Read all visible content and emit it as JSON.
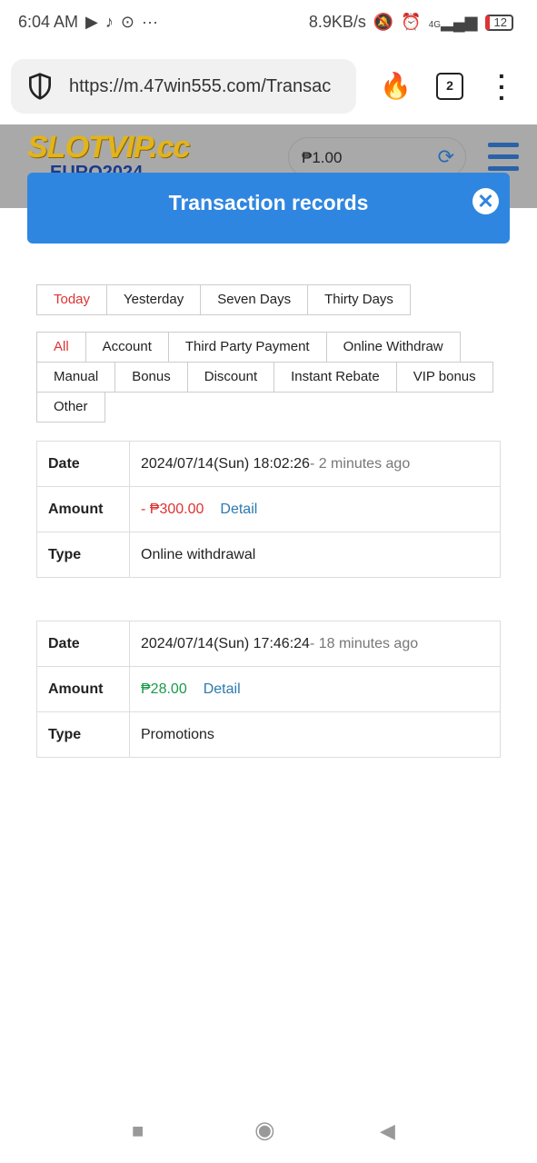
{
  "status": {
    "time": "6:04 AM",
    "speed": "8.9KB/s",
    "network": "4G",
    "battery": "12"
  },
  "browser": {
    "url": "https://m.47win555.com/Transac",
    "tab_count": "2"
  },
  "site": {
    "logo": "SLOTVIP.cc",
    "logo_sub": "EURO2024",
    "balance": "₱1.00"
  },
  "modal": {
    "title": "Transaction records"
  },
  "periods": [
    {
      "label": "Today",
      "active": true
    },
    {
      "label": "Yesterday"
    },
    {
      "label": "Seven Days"
    },
    {
      "label": "Thirty Days"
    }
  ],
  "categories": [
    {
      "label": "All",
      "active": true
    },
    {
      "label": "Account"
    },
    {
      "label": "Third Party Payment"
    },
    {
      "label": "Online Withdraw"
    },
    {
      "label": "Manual"
    },
    {
      "label": "Bonus"
    },
    {
      "label": "Discount"
    },
    {
      "label": "Instant Rebate"
    },
    {
      "label": "VIP bonus"
    },
    {
      "label": "Other"
    }
  ],
  "labels": {
    "date": "Date",
    "amount": "Amount",
    "type": "Type",
    "detail": "Detail"
  },
  "records": [
    {
      "date": "2024/07/14(Sun) 18:02:26",
      "ago": "- 2 minutes ago",
      "amount": "- ₱300.00",
      "amount_color": "#d33333",
      "type": "Online withdrawal"
    },
    {
      "date": "2024/07/14(Sun) 17:46:24",
      "ago": "- 18 minutes ago",
      "amount": "₱28.00",
      "amount_color": "#1a9a4a",
      "type": "Promotions"
    }
  ]
}
